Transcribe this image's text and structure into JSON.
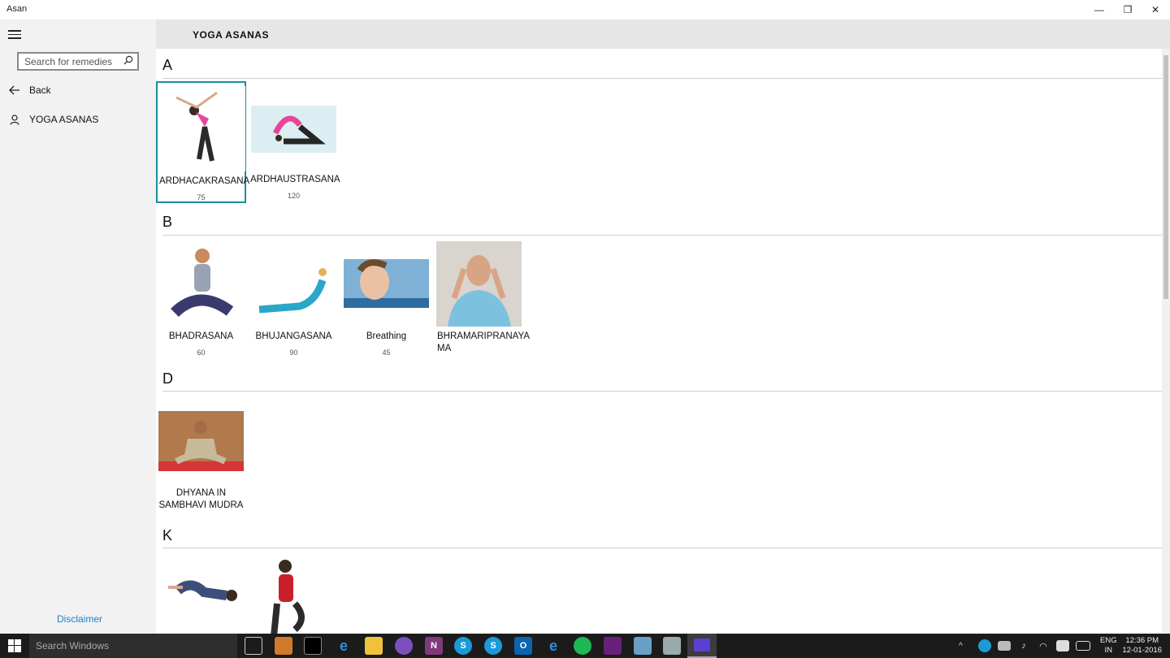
{
  "window": {
    "title": "Asan",
    "minimize_glyph": "—",
    "restore_glyph": "❐",
    "close_glyph": "✕"
  },
  "sidebar": {
    "search_placeholder": "Search for remedies",
    "items": [
      {
        "label": "Back",
        "icon": "back-arrow-icon"
      },
      {
        "label": "YOGA ASANAS",
        "icon": "person-icon"
      }
    ],
    "disclaimer": "Disclaimer"
  },
  "header": {
    "title": "YOGA ASANAS"
  },
  "groups": [
    {
      "letter": "A",
      "items": [
        {
          "name": "ARDHACAKRASANA",
          "count": "75",
          "selected": true
        },
        {
          "name": "ARDHAUSTRASANA",
          "count": "120"
        }
      ]
    },
    {
      "letter": "B",
      "items": [
        {
          "name": "BHADRASANA",
          "count": "60"
        },
        {
          "name": "BHUJANGASANA",
          "count": "90"
        },
        {
          "name": "Breathing",
          "count": "45"
        },
        {
          "name": "BHRAMARIPRANAYA MA",
          "count": ""
        }
      ]
    },
    {
      "letter": "D",
      "items": [
        {
          "name": "DHYANA IN SAMBHAVI MUDRA",
          "count": ""
        }
      ]
    },
    {
      "letter": "K",
      "items": [
        {
          "name": "",
          "count": ""
        },
        {
          "name": "",
          "count": ""
        }
      ]
    }
  ],
  "taskbar": {
    "search_placeholder": "Search Windows",
    "language": "ENG",
    "region": "IN",
    "time": "12:36 PM",
    "date": "12-01-2016"
  },
  "colors": {
    "accent": "#1a8ea3",
    "sidebar_bg": "#f2f2f2",
    "header_bg": "#e6e6e6",
    "link": "#1a7fc4",
    "taskbar_bg": "#1b1b1b"
  }
}
